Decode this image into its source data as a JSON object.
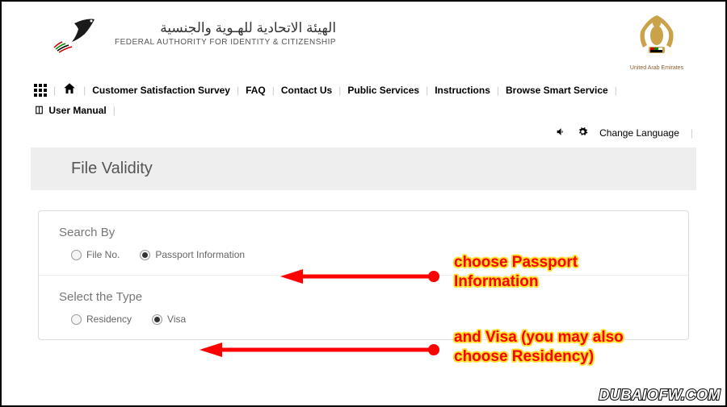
{
  "header": {
    "title_ar": "الهيئة الاتحادية للهـوية والجنسية",
    "title_en": "FEDERAL AUTHORITY FOR IDENTITY & CITIZENSHIP",
    "emblem_label": "United Arab Emirates"
  },
  "nav": {
    "items": [
      "Customer Satisfaction Survey",
      "FAQ",
      "Contact Us",
      "Public Services",
      "Instructions",
      "Browse Smart Service"
    ],
    "user_manual": "User Manual"
  },
  "topbar": {
    "change_language": "Change Language"
  },
  "page": {
    "title": "File Validity"
  },
  "form": {
    "search_by": {
      "label": "Search By",
      "options": [
        {
          "label": "File No.",
          "checked": false
        },
        {
          "label": "Passport Information",
          "checked": true
        }
      ]
    },
    "select_type": {
      "label": "Select the Type",
      "options": [
        {
          "label": "Residency",
          "checked": false
        },
        {
          "label": "Visa",
          "checked": true
        }
      ]
    }
  },
  "annotations": {
    "ann1": "choose Passport\nInformation",
    "ann2": "and Visa (you may also\nchoose Residency)"
  },
  "watermark": "DUBAIOFW.COM"
}
